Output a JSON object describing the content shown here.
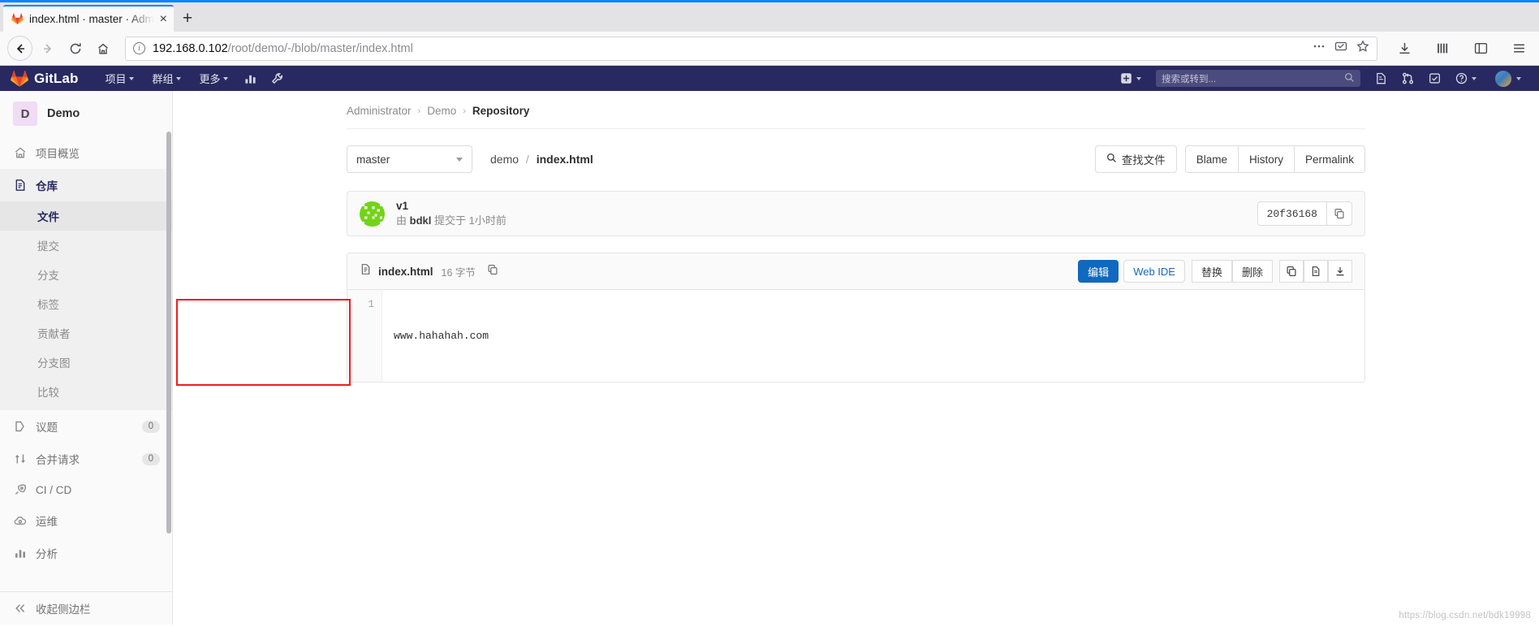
{
  "browser": {
    "tab": {
      "title": "index.html · master · Adm",
      "favicon": "gitlab-favicon",
      "close": "×"
    },
    "newtab_label": "+",
    "url": {
      "host": "192.168.0.102",
      "path": "/root/demo/-/blob/master/index.html"
    },
    "nav": {
      "back": "‹",
      "forward": "›",
      "reload": "⟳",
      "home": "⌂"
    }
  },
  "gitlab_nav": {
    "brand": "GitLab",
    "items": [
      {
        "label": "项目",
        "name": "nav-projects"
      },
      {
        "label": "群组",
        "name": "nav-groups"
      },
      {
        "label": "更多",
        "name": "nav-more"
      }
    ],
    "search_placeholder": "搜索或转到...",
    "icons": [
      "activity-icon",
      "wrench-icon",
      "plus-square-icon",
      "snippets-icon",
      "merge-requests-icon",
      "todos-icon",
      "help-icon",
      "avatar"
    ]
  },
  "sidebar": {
    "project": {
      "initial": "D",
      "name": "Demo"
    },
    "items": [
      {
        "label": "项目概览",
        "icon": "home-icon",
        "active": false
      },
      {
        "label": "仓库",
        "icon": "doc-icon",
        "active": true
      },
      {
        "label": "议题",
        "icon": "issues-icon",
        "badge": "0"
      },
      {
        "label": "合并请求",
        "icon": "merge-icon",
        "badge": "0"
      },
      {
        "label": "CI / CD",
        "icon": "rocket-icon"
      },
      {
        "label": "运维",
        "icon": "cloud-gear-icon"
      },
      {
        "label": "分析",
        "icon": "chart-icon"
      }
    ],
    "sub_items": [
      {
        "label": "文件",
        "active": true
      },
      {
        "label": "提交",
        "active": false
      },
      {
        "label": "分支",
        "active": false
      },
      {
        "label": "标签",
        "active": false
      },
      {
        "label": "贡献者",
        "active": false
      },
      {
        "label": "分支图",
        "active": false
      },
      {
        "label": "比较",
        "active": false
      }
    ],
    "collapse": {
      "label": "收起侧边栏",
      "icon": "double-chevron-left-icon"
    }
  },
  "breadcrumb": [
    {
      "label": "Administrator",
      "last": false
    },
    {
      "label": "Demo",
      "last": false
    },
    {
      "label": "Repository",
      "last": true
    }
  ],
  "filebar": {
    "branch": "master",
    "path_dir": "demo",
    "path_sep": "/",
    "path_file": "index.html",
    "actions": [
      {
        "label": "查找文件",
        "icon": "search-icon"
      },
      {
        "label": "Blame",
        "icon": ""
      },
      {
        "label": "History",
        "icon": ""
      },
      {
        "label": "Permalink",
        "icon": ""
      }
    ]
  },
  "commit": {
    "title": "v1",
    "meta_prefix": "由",
    "author": "bdkl",
    "meta_middle": "提交于",
    "time": "1小时前",
    "sha": "20f36168",
    "copy_icon": "copy-icon"
  },
  "blob": {
    "file_icon": "file-icon",
    "name": "index.html",
    "size": "16 字节",
    "copy_icon": "copy-path-icon",
    "actions": {
      "edit": "编辑",
      "web_ide": "Web IDE",
      "replace": "替换",
      "delete": "删除",
      "copy_icon": "copy-contents-icon",
      "raw_icon": "open-raw-icon",
      "download_icon": "download-icon"
    },
    "lines": [
      {
        "num": "1",
        "text": "www.hahahah.com"
      }
    ]
  },
  "annotation": {
    "color": "#f01c1c",
    "name": "red-highlight-box"
  },
  "watermark": "https://blog.csdn.net/bdk19998"
}
